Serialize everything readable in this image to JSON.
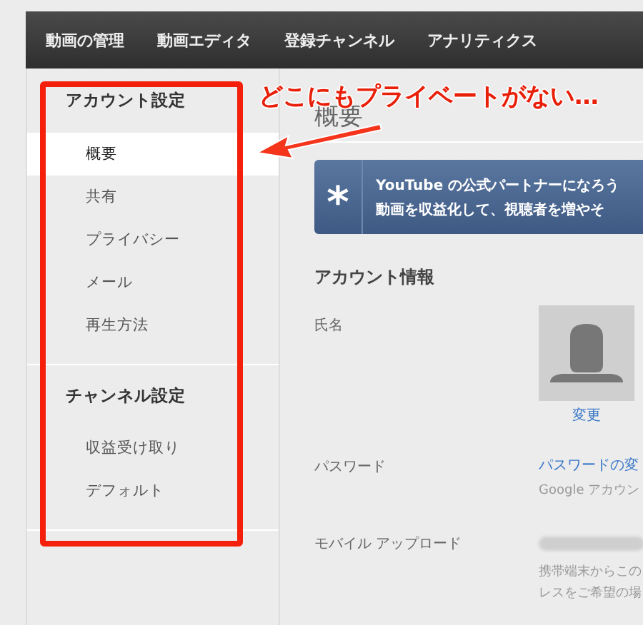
{
  "nav": {
    "tabs": [
      {
        "label": "動画の管理"
      },
      {
        "label": "動画エディタ"
      },
      {
        "label": "登録チャンネル"
      },
      {
        "label": "アナリティクス"
      }
    ]
  },
  "sidebar": {
    "sections": [
      {
        "title": "アカウント設定",
        "items": [
          {
            "label": "概要",
            "selected": true
          },
          {
            "label": "共有",
            "selected": false
          },
          {
            "label": "プライバシー",
            "selected": false
          },
          {
            "label": "メール",
            "selected": false
          },
          {
            "label": "再生方法",
            "selected": false
          }
        ]
      },
      {
        "title": "チャンネル設定",
        "items": [
          {
            "label": "収益受け取り",
            "selected": false
          },
          {
            "label": "デフォルト",
            "selected": false
          }
        ]
      }
    ]
  },
  "annotation": {
    "text": "どこにもプライベートがない…"
  },
  "content": {
    "title": "概要",
    "banner": {
      "icon": "*",
      "lines": [
        "YouTube の公式パートナーになろう",
        "動画を収益化して、視聴者を増やそ"
      ]
    },
    "section_title": "アカウント情報",
    "fields": [
      {
        "kind": "avatar",
        "label": "氏名",
        "link": "変更"
      },
      {
        "kind": "link",
        "label": "パスワード",
        "link": "パスワードの変",
        "note": "Google アカウン"
      },
      {
        "kind": "redacted",
        "label": "モバイル アップロード",
        "notes": [
          "携帯端末からこの",
          "レスをご希望の場"
        ]
      }
    ]
  }
}
